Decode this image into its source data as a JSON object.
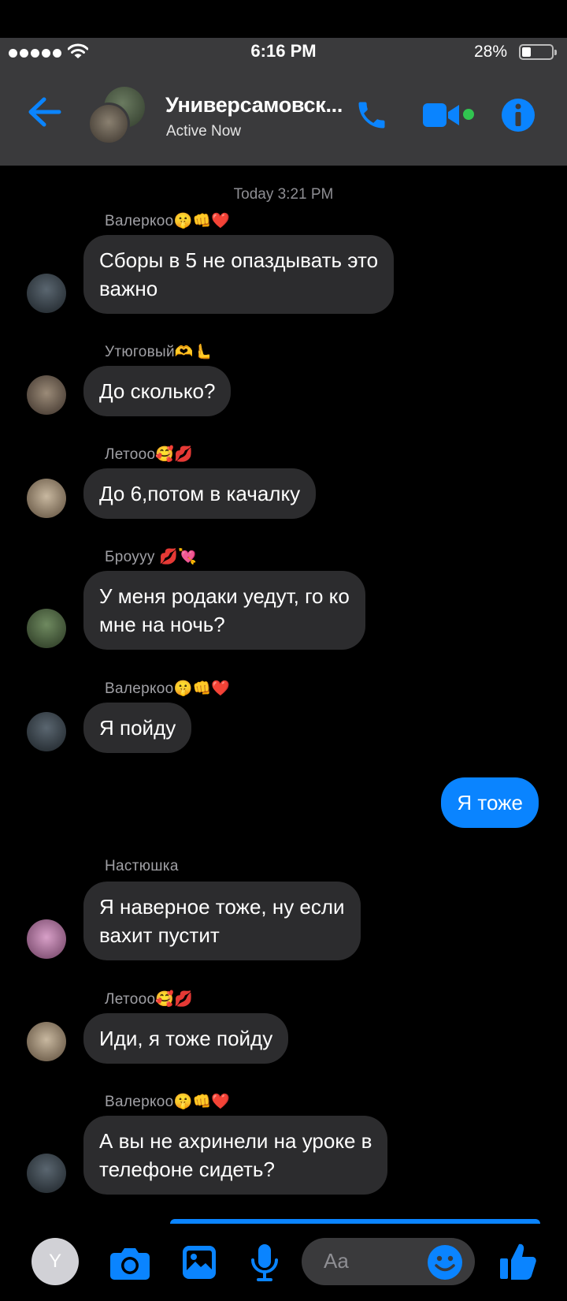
{
  "status": {
    "time": "6:16 PM",
    "battery": "28%"
  },
  "header": {
    "title": "Универсамовск...",
    "subtitle": "Active Now"
  },
  "timestamp": "Today 3:21 PM",
  "messages": [
    {
      "sender": "Валеркоо🤫👊❤️",
      "text": "Сборы в 5 не опаздывать это\nважно"
    },
    {
      "sender": "Утюговый🫶🫷",
      "text": "До сколько?"
    },
    {
      "sender": "Летооо🥰💋",
      "text": "До 6,потом в качалку"
    },
    {
      "sender": "Броууу 💋💘",
      "text": "У меня родаки уедут, го ко\nмне на ночь?"
    },
    {
      "sender": "Валеркоо🤫👊❤️",
      "text": "Я пойду"
    },
    {
      "sender": "",
      "text": "Я тоже"
    },
    {
      "sender": "Настюшка",
      "text": "Я наверное тоже, ну если\nвахит пустит"
    },
    {
      "sender": "Летооо🥰💋",
      "text": "Иди, я тоже пойду"
    },
    {
      "sender": "Валеркоо🤫👊❤️",
      "text": "А вы не ахринели на уроке в\nтелефоне сидеть?"
    }
  ],
  "composer": {
    "avatar_letter": "Y",
    "placeholder": "Aa"
  },
  "colors": {
    "accent": "#0a84ff",
    "online": "#31c450",
    "header_bg": "#3a3a3c",
    "bubble_bg": "#2c2c2e"
  },
  "icons": [
    "back-arrow-icon",
    "phone-icon",
    "video-icon",
    "info-icon",
    "camera-icon",
    "photo-icon",
    "microphone-icon",
    "emoji-icon",
    "thumbs-up-icon"
  ]
}
